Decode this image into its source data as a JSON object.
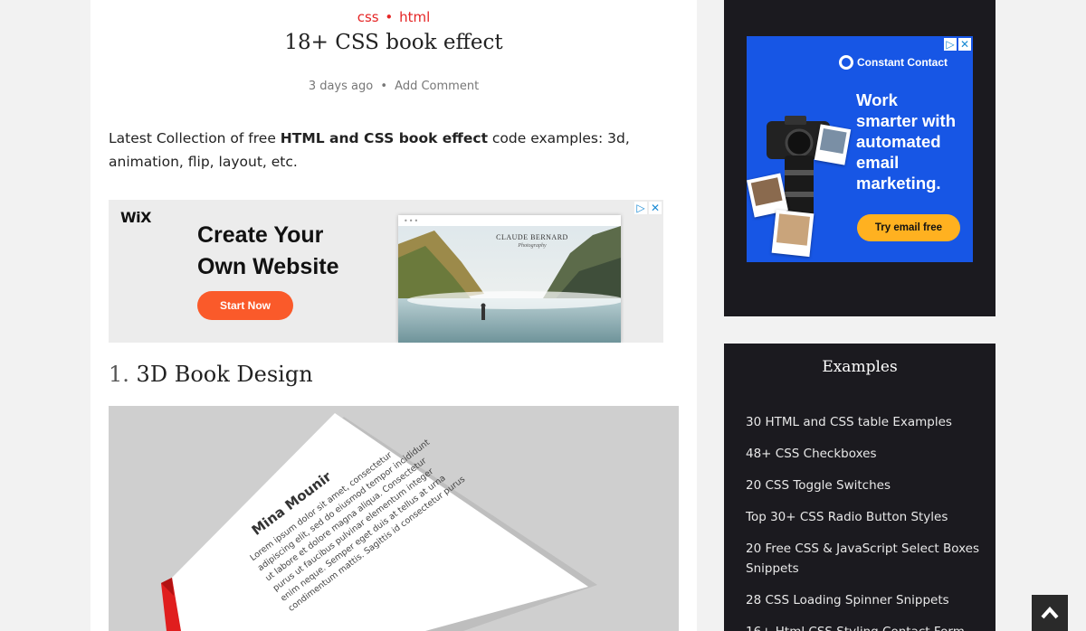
{
  "post": {
    "categories": [
      "css",
      "html"
    ],
    "category_separator": "•",
    "title": "18+ CSS book effect",
    "time_ago": "3 days ago",
    "meta_separator": "•",
    "comment_link": "Add Comment",
    "intro_before": "Latest Collection of free ",
    "intro_bold": "HTML and CSS book effect",
    "intro_after": " code examples: 3d, animation, flip, layout, etc."
  },
  "ad_wix": {
    "logo": "WiX",
    "headline_line1": "Create Your",
    "headline_line2": "Own Website",
    "cta": "Start Now",
    "preview_brand": "CLAUDE BERNARD",
    "preview_sub": "Photography",
    "preview_dots": "•••",
    "adchoices_icon": "play-icon",
    "close_icon": "close-icon"
  },
  "section": {
    "number": "1.",
    "title": "3D Book Design"
  },
  "book_image": {
    "author": "Mina Mounir",
    "line1": "Lorem ipsum dolor sit amet, consectetur",
    "line2": "adipiscing elit, sed do eiusmod tempor incididunt",
    "line3": "ut labore et dolore magna aliqua. Consectetur",
    "line4": "purus ut faucibus pulvinar elementum integer",
    "line5": "enim neque. Semper eget duis at tellus at urna",
    "line6": "condimentum mattis. Sagittis id consectetur purus"
  },
  "ad_cc": {
    "brand": "Constant Contact",
    "headline_line1": "Work",
    "headline_line2": "smarter with",
    "headline_line3": "automated",
    "headline_line4": "email",
    "headline_line5": "marketing.",
    "cta": "Try email free"
  },
  "widget": {
    "title": "Examples",
    "links": [
      "30 HTML and CSS table Examples",
      "48+ CSS Checkboxes",
      "20 CSS Toggle Switches",
      "Top 30+ CSS Radio Button Styles",
      "20 Free CSS & JavaScript Select Boxes Snippets",
      "28 CSS Loading Spinner Snippets",
      "16+ Html CSS Styling Contact Form"
    ]
  },
  "back_to_top_icon": "chevron-up-icon",
  "colors": {
    "accent": "#e52525",
    "sidebar_bg": "#1b1a1f",
    "wix_cta": "#fa5a2a",
    "cc_blue": "#1756e5",
    "cc_cta": "#ffb120"
  }
}
